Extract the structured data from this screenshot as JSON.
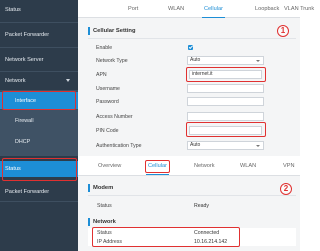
{
  "panel1": {
    "sidebar": {
      "items": [
        {
          "label": "Status"
        },
        {
          "label": "Packet Forwarder"
        },
        {
          "label": "Network Server"
        },
        {
          "label": "Network"
        }
      ],
      "subitems": [
        {
          "label": "Interface"
        },
        {
          "label": "Firewall"
        },
        {
          "label": "DHCP"
        }
      ]
    },
    "tabs": [
      "Port",
      "WLAN",
      "Cellular",
      "Loopback",
      "VLAN Trunk"
    ],
    "section_title": "Cellular Setting",
    "fields": {
      "enable": {
        "label": "Enable",
        "checked": true
      },
      "network_type": {
        "label": "Network Type",
        "value": "Auto"
      },
      "apn": {
        "label": "APN",
        "value": "internet.it"
      },
      "username": {
        "label": "Username",
        "value": ""
      },
      "password": {
        "label": "Password",
        "value": ""
      },
      "access_number": {
        "label": "Access Number",
        "value": ""
      },
      "pin_code": {
        "label": "PIN Code",
        "value": ""
      },
      "auth_type": {
        "label": "Authentication Type",
        "value": "Auto"
      }
    },
    "step_badge": "1"
  },
  "panel2": {
    "sidebar": {
      "items": [
        {
          "label": "Status"
        },
        {
          "label": "Packet Forwarder"
        }
      ]
    },
    "tabs": [
      "Overview",
      "Cellular",
      "Network",
      "WLAN",
      "VPN"
    ],
    "modem": {
      "title": "Modem",
      "status_label": "Status",
      "status_value": "Ready"
    },
    "network": {
      "title": "Network",
      "status_label": "Status",
      "status_value": "Connected",
      "ip_label": "IP Address",
      "ip_value": "10.16.214.142"
    },
    "step_badge": "2"
  },
  "colors": {
    "sidebar": "#2d3c4b",
    "accent": "#1d8ed6",
    "highlight": "#e03131"
  }
}
